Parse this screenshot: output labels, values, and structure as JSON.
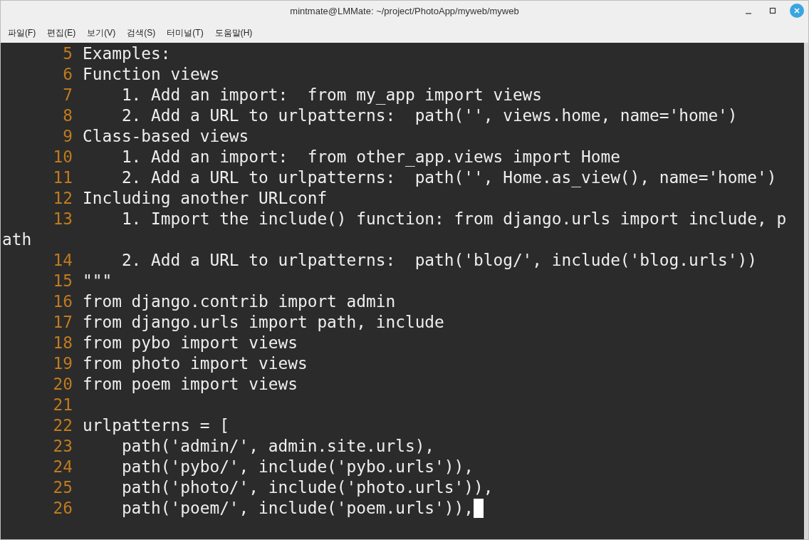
{
  "window": {
    "title": "mintmate@LMMate: ~/project/PhotoApp/myweb/myweb"
  },
  "menu": [
    "파일(F)",
    "편집(E)",
    "보기(V)",
    "검색(S)",
    "터미널(T)",
    "도움말(H)"
  ],
  "editor": {
    "lines": [
      {
        "kind": "line",
        "number": "5",
        "text": "Examples:",
        "cursor": false
      },
      {
        "kind": "line",
        "number": "6",
        "text": "Function views",
        "cursor": false
      },
      {
        "kind": "line",
        "number": "7",
        "text": "    1. Add an import:  from my_app import views",
        "cursor": false
      },
      {
        "kind": "line",
        "number": "8",
        "text": "    2. Add a URL to urlpatterns:  path('', views.home, name='home')",
        "cursor": false
      },
      {
        "kind": "line",
        "number": "9",
        "text": "Class-based views",
        "cursor": false
      },
      {
        "kind": "line",
        "number": "10",
        "text": "    1. Add an import:  from other_app.views import Home",
        "cursor": false
      },
      {
        "kind": "line",
        "number": "11",
        "text": "    2. Add a URL to urlpatterns:  path('', Home.as_view(), name='home')",
        "cursor": false
      },
      {
        "kind": "line",
        "number": "12",
        "text": "Including another URLconf",
        "cursor": false
      },
      {
        "kind": "line",
        "number": "13",
        "text": "    1. Import the include() function: from django.urls import include, p",
        "cursor": false
      },
      {
        "kind": "continuation",
        "text": "ath"
      },
      {
        "kind": "line",
        "number": "14",
        "text": "    2. Add a URL to urlpatterns:  path('blog/', include('blog.urls'))",
        "cursor": false
      },
      {
        "kind": "line",
        "number": "15",
        "text": "\"\"\"",
        "cursor": false
      },
      {
        "kind": "line",
        "number": "16",
        "text": "from django.contrib import admin",
        "cursor": false
      },
      {
        "kind": "line",
        "number": "17",
        "text": "from django.urls import path, include",
        "cursor": false
      },
      {
        "kind": "line",
        "number": "18",
        "text": "from pybo import views",
        "cursor": false
      },
      {
        "kind": "line",
        "number": "19",
        "text": "from photo import views",
        "cursor": false
      },
      {
        "kind": "line",
        "number": "20",
        "text": "from poem import views",
        "cursor": false
      },
      {
        "kind": "line",
        "number": "21",
        "cursor": false
      },
      {
        "kind": "line",
        "number": "22",
        "text": "urlpatterns = [",
        "cursor": false
      },
      {
        "kind": "line",
        "number": "23",
        "text": "    path('admin/', admin.site.urls),",
        "cursor": false
      },
      {
        "kind": "line",
        "number": "24",
        "text": "    path('pybo/', include('pybo.urls')),",
        "cursor": false
      },
      {
        "kind": "line",
        "number": "25",
        "text": "    path('photo/', include('photo.urls')),",
        "cursor": false
      },
      {
        "kind": "line",
        "number": "26",
        "text": "    path('poem/', include('poem.urls')),",
        "cursor": true
      }
    ]
  }
}
